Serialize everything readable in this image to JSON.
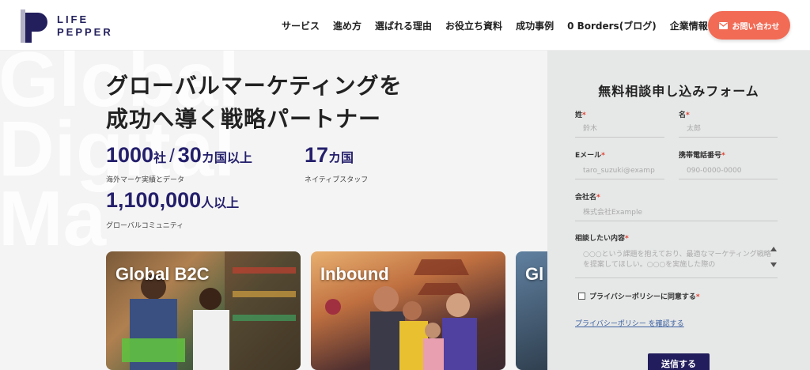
{
  "brand": {
    "logo_line1": "LIFE",
    "logo_line2": "PEPPER",
    "colors": {
      "navy": "#221f5c",
      "cta": "#f26b55",
      "accent_purple": "#241f6b"
    }
  },
  "nav": {
    "items": [
      {
        "label": "サービス"
      },
      {
        "label": "進め方"
      },
      {
        "label": "選ばれる理由"
      },
      {
        "label": "お役立ち資料"
      },
      {
        "label": "成功事例"
      },
      {
        "label": "0 Borders(ブログ)"
      },
      {
        "label": "企業情報"
      }
    ],
    "cta_label": "お問い合わせ",
    "cta_icon": "mail-icon"
  },
  "hero": {
    "bg_text": [
      "Global",
      "Digital",
      "Ma"
    ],
    "headline_line1": "グローバルマーケティングを",
    "headline_line2": "成功へ導く戦略パートナー",
    "stats": [
      {
        "num": "1000",
        "unit": "社",
        "sep": "/",
        "num2": "30",
        "unit2": "カ国以上",
        "caption": "海外マーケ実績とデータ"
      },
      {
        "num": "17",
        "unit": "カ国",
        "caption": "ネイティブスタッフ"
      },
      {
        "num": "1,100,000",
        "unit": "人以上",
        "caption": "グローバルコミュニティ"
      }
    ],
    "cards": [
      {
        "title": "Global B2C"
      },
      {
        "title": "Inbound"
      },
      {
        "title": "Gl"
      }
    ]
  },
  "form": {
    "title": "無料相談申し込みフォーム",
    "required_mark": "*",
    "fields": {
      "last_name": {
        "label": "姓",
        "placeholder": "鈴木"
      },
      "first_name": {
        "label": "名",
        "placeholder": "太郎"
      },
      "email": {
        "label": "Eメール",
        "placeholder": "taro_suzuki@examp"
      },
      "phone": {
        "label": "携帯電話番号",
        "placeholder": "090-0000-0000"
      },
      "company": {
        "label": "会社名",
        "placeholder": "株式会社Example"
      },
      "inquiry": {
        "label": "相談したい内容",
        "placeholder": "○○○という課題を抱えており、最適なマーケティング戦略を提案してほしい。○○○を実施した際の"
      }
    },
    "privacy_checkbox_label": "プライバシーポリシーに同意する",
    "privacy_link": "プライバシーポリシー を確認する",
    "submit_label": "送信する"
  }
}
